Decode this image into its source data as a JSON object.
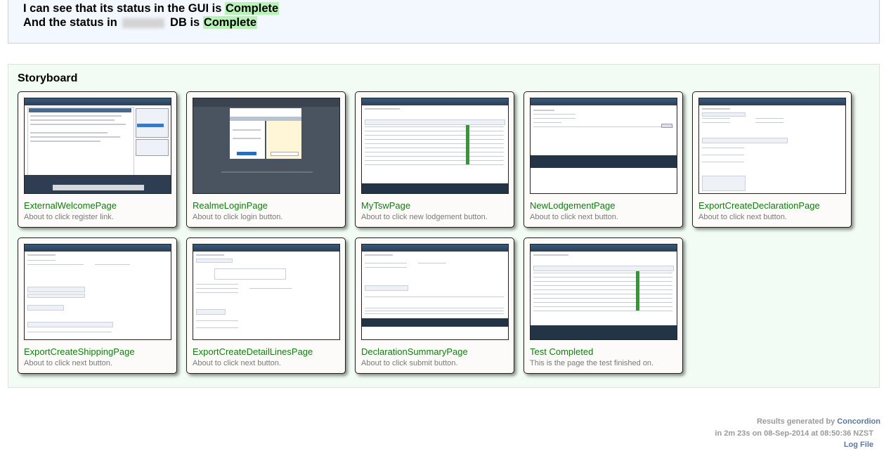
{
  "status": {
    "line1_prefix": "I can see that its status in the GUI is",
    "line1_value": "Complete",
    "line2_prefix": "And the status in",
    "line2_suffix": "DB is",
    "line2_value": "Complete"
  },
  "storyboard": {
    "title": "Storyboard",
    "cards": [
      {
        "title": "ExternalWelcomePage",
        "description": "About to click register link."
      },
      {
        "title": "RealmeLoginPage",
        "description": "About to click login button."
      },
      {
        "title": "MyTswPage",
        "description": "About to click new lodgement button."
      },
      {
        "title": "NewLodgementPage",
        "description": "About to click next button."
      },
      {
        "title": "ExportCreateDeclarationPage",
        "description": "About to click next button."
      },
      {
        "title": "ExportCreateShippingPage",
        "description": "About to click next button."
      },
      {
        "title": "ExportCreateDetailLinesPage",
        "description": "About to click next button."
      },
      {
        "title": "DeclarationSummaryPage",
        "description": "About to click submit button."
      },
      {
        "title": "Test Completed",
        "description": "This is the page the test finished on."
      }
    ]
  },
  "footer": {
    "generated_prefix": "Results generated by",
    "generator": "Concordion",
    "timing": "in 2m 23s on 08-Sep-2014 at 08:50:36 NZST",
    "log_link": "Log File"
  }
}
